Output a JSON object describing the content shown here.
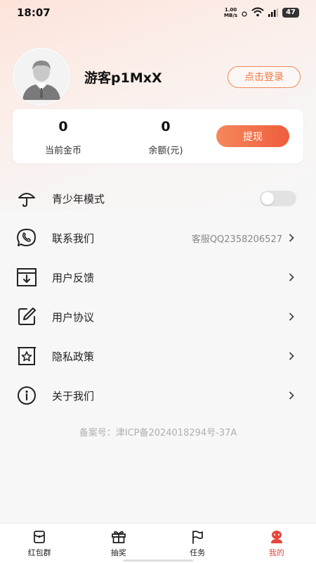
{
  "status_bar": {
    "time": "18:07",
    "net_speed_value": "1.00",
    "net_speed_unit": "MB/s",
    "battery": "47"
  },
  "profile": {
    "username": "游客p1MxX",
    "login_label": "点击登录"
  },
  "wallet": {
    "coins_value": "0",
    "coins_label": "当前金币",
    "balance_value": "0",
    "balance_label": "余额(元)",
    "withdraw_label": "提现"
  },
  "menu": {
    "youth_mode": {
      "label": "青少年模式",
      "icon": "umbrella-icon",
      "toggle_on": false
    },
    "contact": {
      "label": "联系我们",
      "extra": "客服QQ2358206527",
      "icon": "phone-chat-icon"
    },
    "feedback": {
      "label": "用户反馈",
      "icon": "feedback-tray-icon"
    },
    "agreement": {
      "label": "用户协议",
      "icon": "edit-icon"
    },
    "privacy": {
      "label": "隐私政策",
      "icon": "star-badge-icon"
    },
    "about": {
      "label": "关于我们",
      "icon": "info-icon"
    }
  },
  "icp": "备案号：津ICP备2024018294号-37A",
  "tabs": [
    {
      "label": "红包群",
      "icon": "red-packet-icon",
      "active": false
    },
    {
      "label": "抽奖",
      "icon": "gift-icon",
      "active": false
    },
    {
      "label": "任务",
      "icon": "flag-icon",
      "active": false
    },
    {
      "label": "我的",
      "icon": "profile-icon",
      "active": true
    }
  ],
  "colors": {
    "accent": "#ee5d3c",
    "accent_light": "#f6875a",
    "tab_active": "#e8453a"
  }
}
